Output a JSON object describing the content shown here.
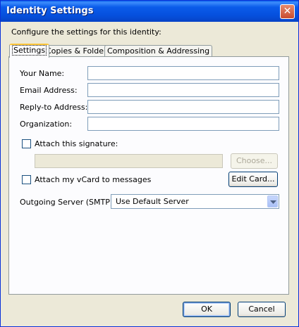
{
  "window": {
    "title": "Identity Settings",
    "close_glyph": "✕"
  },
  "intro": "Configure the settings for this identity:",
  "tabs": [
    {
      "label": "Settings",
      "active": true
    },
    {
      "label": "Copies & Folders",
      "active": false
    },
    {
      "label": "Composition & Addressing",
      "active": false
    }
  ],
  "fields": {
    "your_name": {
      "label": "Your Name:",
      "value": ""
    },
    "email": {
      "label": "Email Address:",
      "value": ""
    },
    "reply_to": {
      "label": "Reply-to Address:",
      "value": ""
    },
    "organization": {
      "label": "Organization:",
      "value": ""
    }
  },
  "signature": {
    "label": "Attach this signature:",
    "checked": false,
    "path": "",
    "choose_label": "Choose..."
  },
  "vcard": {
    "label": "Attach my vCard to messages",
    "checked": false,
    "edit_label": "Edit Card..."
  },
  "smtp": {
    "label": "Outgoing Server (SMTP):",
    "selected": "Use Default Server"
  },
  "footer": {
    "ok_label": "OK",
    "cancel_label": "Cancel"
  },
  "colors": {
    "titlebar": "#0550dd",
    "dialog_bg": "#ece9d8",
    "tab_highlight": "#ffc83c"
  }
}
